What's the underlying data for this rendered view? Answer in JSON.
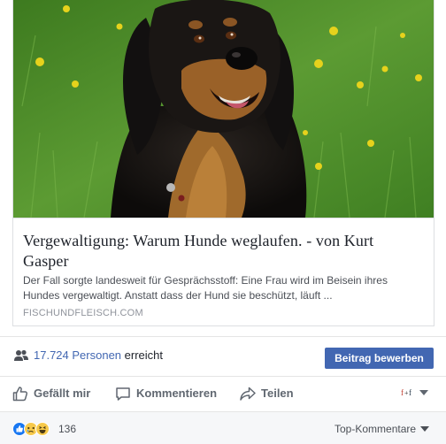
{
  "link_preview": {
    "title": "Vergewaltigung: Warum Hunde weglaufen. - von Kurt Gasper",
    "description": "Der Fall sorgte landesweit für Gesprächsstoff: Eine Frau wird im Beisein ihres Hundes vergewaltigt. Anstatt dass der Hund sie beschützt, läuft ...",
    "domain": "FISCHUNDFLEISCH.COM",
    "image_icon": "dog-photo"
  },
  "reach": {
    "count": "17.724 Personen",
    "label": "erreicht",
    "promote_button": "Beitrag bewerben"
  },
  "actions": {
    "like": "Gefällt mir",
    "comment": "Kommentieren",
    "share": "Teilen"
  },
  "summary": {
    "reaction_count": "136",
    "top_comments": "Top-Kommentare"
  },
  "colors": {
    "link_blue": "#4267b2",
    "like_blue": "#1877f2",
    "reaction_yellow": "#f7c94a",
    "grass_green": "#4f8a2a"
  }
}
